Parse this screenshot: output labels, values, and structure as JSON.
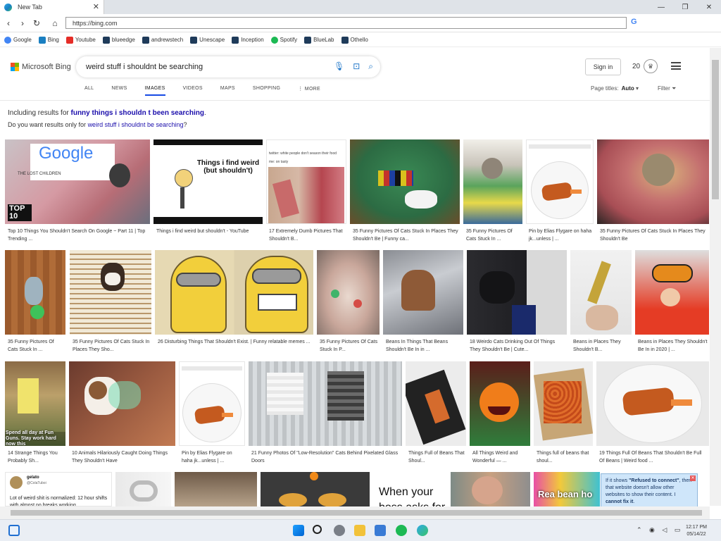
{
  "browser": {
    "tab_title": "New Tab",
    "tab_close": "✕",
    "url": "https://bing.com",
    "bookmarks": [
      {
        "label": "Google",
        "color": "#4285f4"
      },
      {
        "label": "Bing",
        "color": "#1a7fc1"
      },
      {
        "label": "Youtube",
        "color": "#e52d27"
      },
      {
        "label": "blueedge",
        "color": "#1f3b5a"
      },
      {
        "label": "andrewstech",
        "color": "#1f3b5a"
      },
      {
        "label": "Unescape",
        "color": "#1f3b5a"
      },
      {
        "label": "Inception",
        "color": "#1f3b5a"
      },
      {
        "label": "Spotify",
        "color": "#1db954"
      },
      {
        "label": "BlueLab",
        "color": "#1f3b5a"
      },
      {
        "label": "Othello",
        "color": "#1f3b5a"
      }
    ]
  },
  "bing": {
    "logo_text": "Microsoft Bing",
    "query": "weird stuff i shouldnt be searching",
    "sign_in": "Sign in",
    "points": "20",
    "scopes": [
      "ALL",
      "NEWS",
      "IMAGES",
      "VIDEOS",
      "MAPS",
      "SHOPPING",
      "⋮ MORE"
    ],
    "active_scope": "IMAGES",
    "page_titles_label": "Page titles:",
    "page_titles_value": "Auto",
    "filter_label": "Filter",
    "including_prefix": "Including results for ",
    "including_query": "funny things i shouldn t been searching",
    "including_suffix": ".",
    "dym_prefix": "Do you want results only for ",
    "dym_query": "weird stuff i shouldnt be searching",
    "dym_suffix": "?"
  },
  "results": [
    {
      "cap": "Top 10 Things You Shouldn't Search On Google ~ Part 11 | Top Trending ..."
    },
    {
      "cap": "Things i find weird but shouldn't - YouTube"
    },
    {
      "cap": "17 Extremely Dumb Pictures That Shouldn't B..."
    },
    {
      "cap": "35 Funny Pictures Of Cats Stuck In Places They Shouldn't Be | Funny ca..."
    },
    {
      "cap": "35 Funny Pictures Of Cats Stuck In ..."
    },
    {
      "cap": "Pin by Elias Flygare on haha jk...unless | ..."
    },
    {
      "cap": "35 Funny Pictures Of Cats Stuck In Places They Shouldn't Be"
    },
    {
      "cap": "35 Funny Pictures Of Cats Stuck In ..."
    },
    {
      "cap": "35 Funny Pictures Of Cats Stuck In Places They Sho..."
    },
    {
      "cap": "26 Disturbing Things That Shouldn't Exist. | Funny relatable memes ..."
    },
    {
      "cap": "35 Funny Pictures Of Cats Stuck In P..."
    },
    {
      "cap": "Beans In Things That Beans Shouldn't Be In in ..."
    },
    {
      "cap": "18 Weirdo Cats Drinking Out Of Things They Shouldn't Be | Cute..."
    },
    {
      "cap": "Beans in Places They Shouldn't B..."
    },
    {
      "cap": "Beans in Places They Shouldn't Be In in 2020 | ..."
    },
    {
      "cap": "14 Strange Things You Probably Sh..."
    },
    {
      "cap": "10 Animals Hilariously Caught Doing Things They Shouldn't Have"
    },
    {
      "cap": "Pin by Elias Flygare on haha jk...unless | ..."
    },
    {
      "cap": "21 Funny Photos Of \"Low-Resolution\" Cats Behind Pixelated Glass Doors"
    },
    {
      "cap": "Things Full of Beans That Shoul..."
    },
    {
      "cap": "All Things Weird and Wonderful — ..."
    },
    {
      "cap": "Things full of beans that shoul..."
    },
    {
      "cap": "19 Things Full Of Beans That Shouldn't Be Full Of Beans | Weird food ..."
    }
  ],
  "overlays": {
    "google_word": "Google",
    "lost_children": "THE LOST CHILDREN",
    "top10": "TOP 10",
    "things_i_find_weird": "Things i find weird (but shouldn't)",
    "tweet_snippet": "twitter: white people don't season their food",
    "tweet_reply": "me: on tasty",
    "bottom_tweet_user": "gelato",
    "bottom_tweet_handle": "@ColaTuboi",
    "bottom_tweet_text": "Lot of weird shit is normalized: 12 hour shifts with almost no breaks working...",
    "when_your_boss": "When your boss asks for",
    "real_beans": "Rea bean ho",
    "spongebob_text": "Spend all day at Fun Guns. Stay work hard now this"
  },
  "popup": {
    "line1": "If it shows ",
    "refused": "\"Refused to connect\"",
    "line2": ", then that website doesn't allow other websites to show their content. I ",
    "cannot": "cannot fix it",
    "line3": "."
  },
  "taskbar": {
    "time": "12:17 PM",
    "date": "05/14/22"
  }
}
